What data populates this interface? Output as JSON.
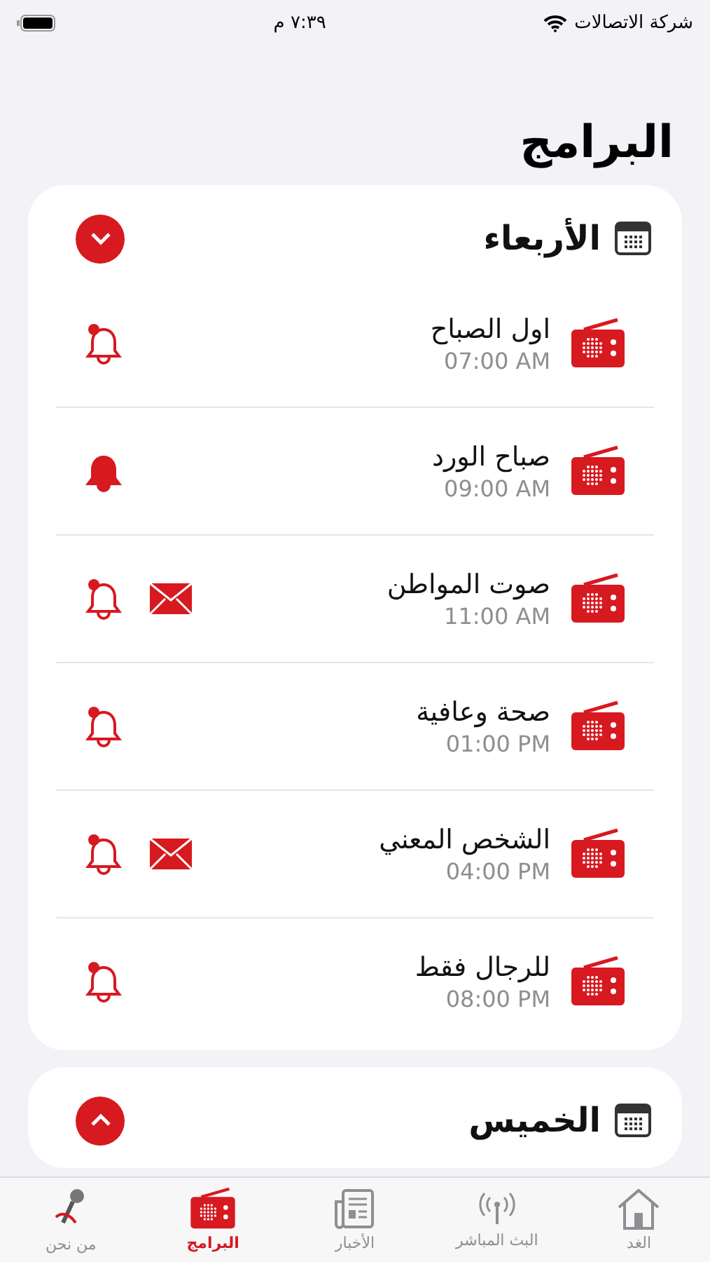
{
  "status_bar": {
    "carrier": "شركة الاتصالات",
    "time": "٧:٣٩ م"
  },
  "title": "البرامج",
  "days": [
    {
      "name": "الأربعاء",
      "expanded": true,
      "programs": [
        {
          "name": "اول الصباح",
          "time": "07:00 AM",
          "reminder": false,
          "message": false
        },
        {
          "name": "صباح الورد",
          "time": "09:00 AM",
          "reminder": true,
          "message": false
        },
        {
          "name": "صوت المواطن",
          "time": "11:00 AM",
          "reminder": false,
          "message": true
        },
        {
          "name": "صحة وعافية",
          "time": "01:00 PM",
          "reminder": false,
          "message": false
        },
        {
          "name": "الشخص المعني",
          "time": "04:00 PM",
          "reminder": false,
          "message": true
        },
        {
          "name": "للرجال فقط",
          "time": "08:00 PM",
          "reminder": false,
          "message": false
        }
      ]
    },
    {
      "name": "الخميس",
      "expanded": false
    }
  ],
  "tabs": [
    {
      "label": "الغد",
      "kind": "home",
      "selected": false
    },
    {
      "label": "البث المباشر",
      "kind": "live",
      "selected": false
    },
    {
      "label": "الأخبار",
      "kind": "news",
      "selected": false
    },
    {
      "label": "البرامج",
      "kind": "programs",
      "selected": true
    },
    {
      "label": "من نحن",
      "kind": "about",
      "selected": false
    }
  ]
}
